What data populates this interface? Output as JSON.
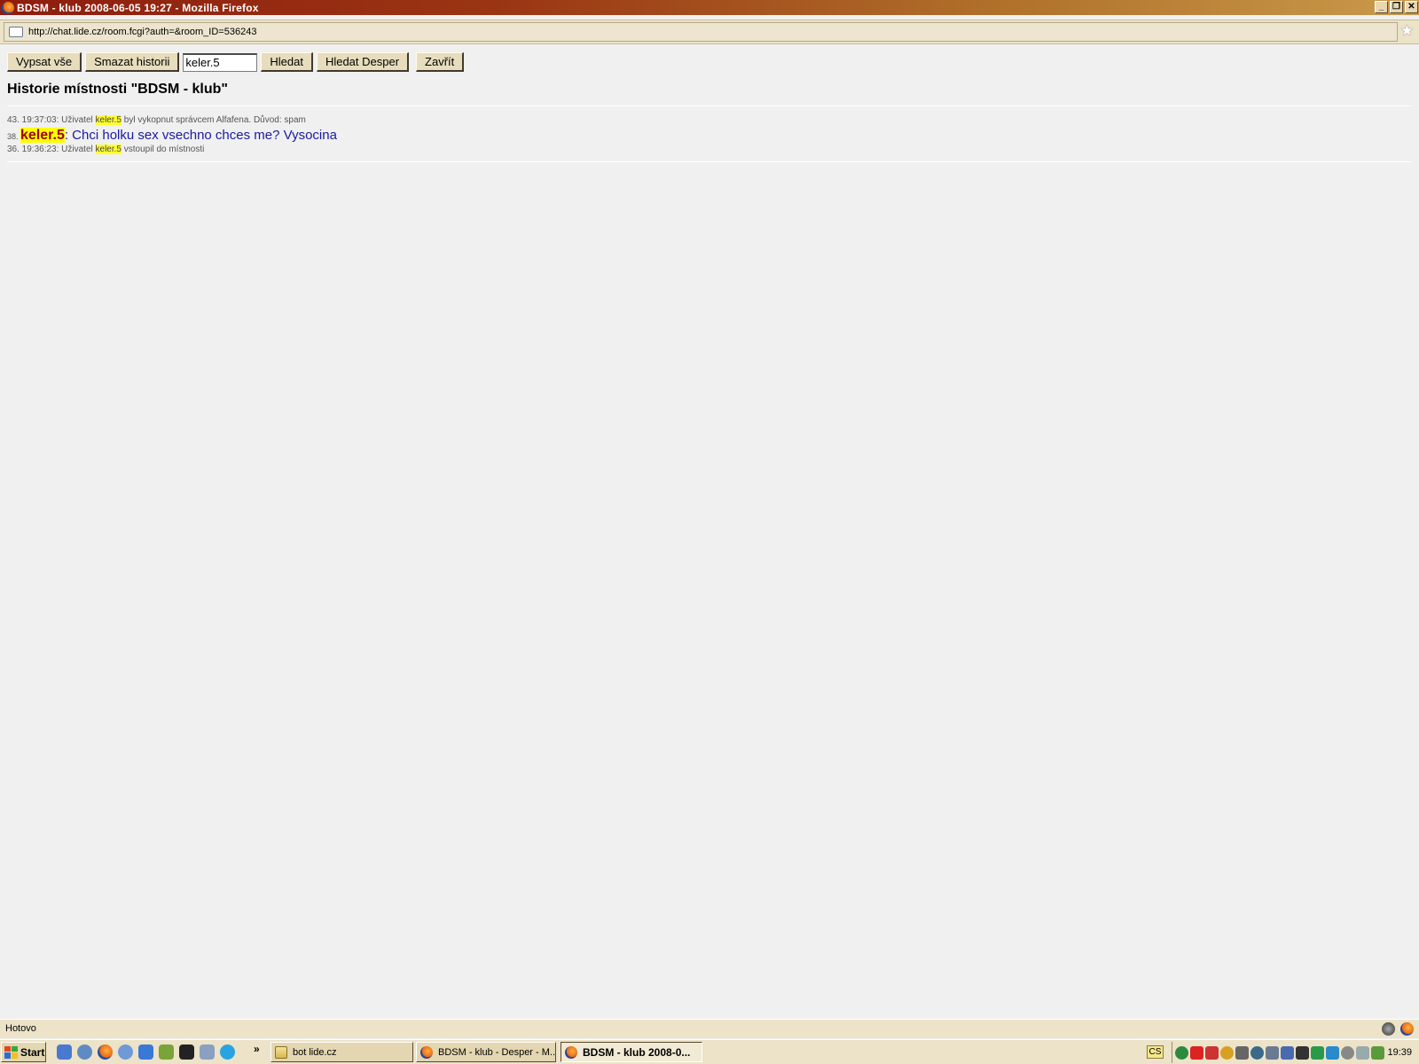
{
  "window": {
    "title": "BDSM - klub 2008-06-05 19:27 - Mozilla Firefox",
    "controls": {
      "minimize": "_",
      "restore": "❐",
      "close": "✕"
    }
  },
  "address_bar": {
    "url": "http://chat.lide.cz/room.fcgi?auth=&room_ID=536243",
    "bookmark_icon": "star-icon"
  },
  "toolbar": {
    "list_all_label": "Vypsat vše",
    "clear_history_label": "Smazat historii",
    "search_value": "keler.5",
    "search_label": "Hledat",
    "search_desper_label": "Hledat Desper",
    "close_label": "Zavřít"
  },
  "page": {
    "title": "Historie místnosti \"BDSM - klub\""
  },
  "history": [
    {
      "prefix": "43. 19:37:03: Uživatel ",
      "nick": "keler.5",
      "suffix": " byl vykopnut správcem Alfafena. Důvod: spam"
    },
    {
      "prefix": "38. ",
      "nick": "keler.5",
      "message": ": Chci holku sex vsechno chces me? Vysocina"
    },
    {
      "prefix": "36. 19:36:23: Uživatel ",
      "nick": "keler.5",
      "suffix": " vstoupil do místnosti"
    }
  ],
  "status_bar": {
    "text": "Hotovo"
  },
  "taskbar": {
    "start_label": "Start",
    "more_label": "»",
    "tasks": [
      {
        "label": "bot lide.cz"
      },
      {
        "label": "BDSM - klub - Desper - M..."
      },
      {
        "label": "BDSM - klub 2008-0..."
      }
    ],
    "language": "CS",
    "clock": "19:39"
  },
  "colors": {
    "highlight": "#ffff00",
    "nick_big": "#990000",
    "message_text": "#1a1aa0"
  }
}
